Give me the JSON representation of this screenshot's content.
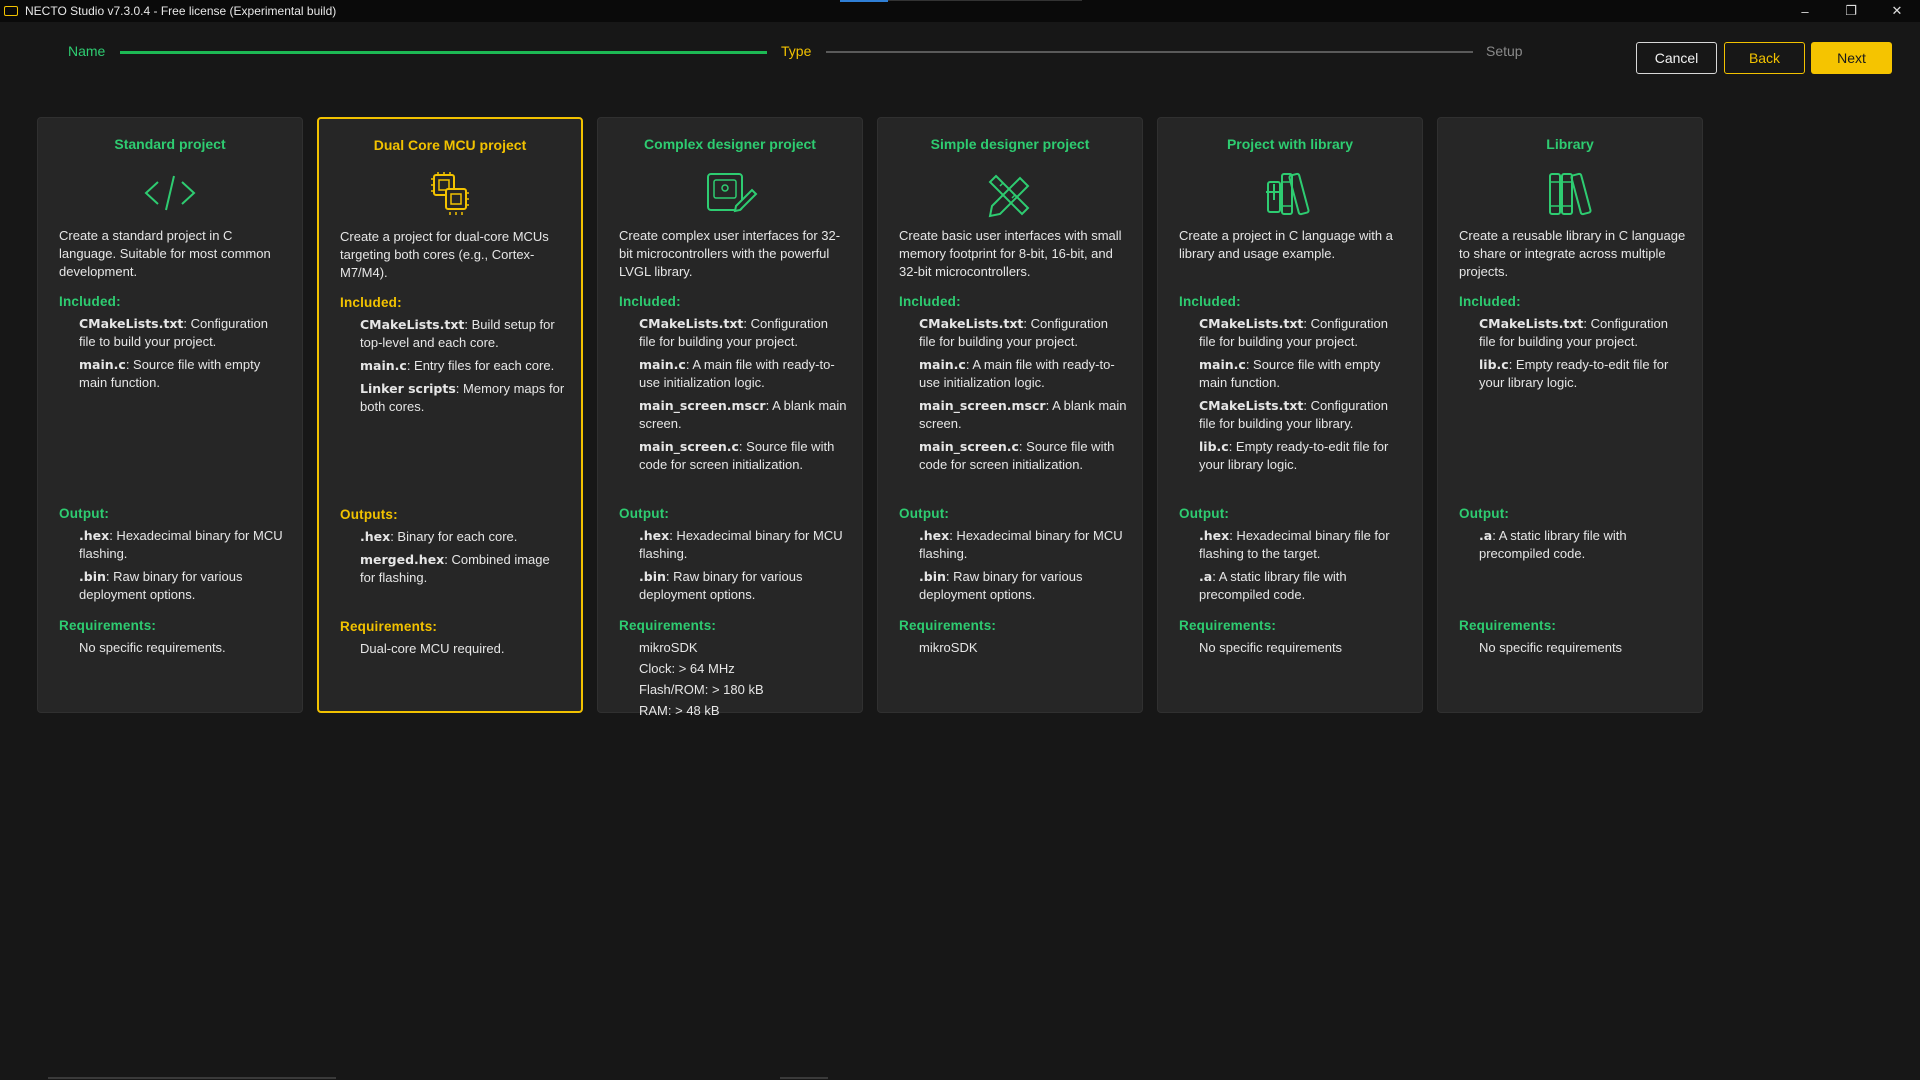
{
  "window": {
    "title": "NECTO Studio v7.3.0.4 - Free license (Experimental build)",
    "controls": {
      "minimize": "–",
      "restore": "❐",
      "close": "✕"
    }
  },
  "stepper": {
    "steps": [
      {
        "label": "Name",
        "state": "done"
      },
      {
        "label": "Type",
        "state": "current"
      },
      {
        "label": "Setup",
        "state": "pending"
      }
    ],
    "progress": 0.5
  },
  "buttons": {
    "cancel": "Cancel",
    "back": "Back",
    "next": "Next"
  },
  "colors": {
    "accent": "#f2c200",
    "green": "#2ecc71",
    "background": "#171717",
    "card": "#262626"
  },
  "cards": [
    {
      "title": "Standard project",
      "icon": "code-brackets-icon",
      "selected": false,
      "description": "Create a standard project in C language. Suitable for most common development.",
      "included_label": "Included:",
      "included": [
        {
          "name": "CMakeLists.txt",
          "text": ": Configuration file to build your project."
        },
        {
          "name": "main.c",
          "text": ": Source file with empty main function."
        }
      ],
      "output_label": "Output:",
      "output": [
        {
          "name": ".hex",
          "text": ": Hexadecimal binary for MCU flashing."
        },
        {
          "name": ".bin",
          "text": ": Raw binary for various deployment options."
        }
      ],
      "requirements_label": "Requirements:",
      "requirements": [
        "No specific requirements."
      ]
    },
    {
      "title": "Dual Core MCU project",
      "icon": "dual-chip-icon",
      "selected": true,
      "description": "Create a project for dual-core MCUs targeting both cores (e.g., Cortex-M7/M4).",
      "included_label": "Included:",
      "included": [
        {
          "name": "CMakeLists.txt",
          "text": ": Build setup for top-level and each core."
        },
        {
          "name": "main.c",
          "text": ": Entry files for each core."
        },
        {
          "name": "Linker scripts",
          "text": ": Memory maps for both cores."
        }
      ],
      "output_label": "Outputs:",
      "output": [
        {
          "name": ".hex",
          "text": ": Binary for each core."
        },
        {
          "name": "merged.hex",
          "text": ": Combined image for flashing."
        }
      ],
      "requirements_label": "Requirements:",
      "requirements": [
        "Dual-core MCU required."
      ]
    },
    {
      "title": "Complex designer project",
      "icon": "designer-screen-icon",
      "selected": false,
      "description": "Create complex user interfaces for 32-bit microcontrollers with the powerful LVGL library.",
      "included_label": "Included:",
      "included": [
        {
          "name": "CMakeLists.txt",
          "text": ": Configuration file for building your project."
        },
        {
          "name": "main.c",
          "text": ": A main file with ready-to-use initialization logic."
        },
        {
          "name": "main_screen.mscr",
          "text": ": A blank main screen."
        },
        {
          "name": "main_screen.c",
          "text": ": Source file with code for screen initialization."
        }
      ],
      "output_label": "Output:",
      "output": [
        {
          "name": ".hex",
          "text": ": Hexadecimal binary for MCU flashing."
        },
        {
          "name": ".bin",
          "text": ": Raw binary for various deployment options."
        }
      ],
      "requirements_label": "Requirements:",
      "requirements": [
        "mikroSDK",
        "Clock: > 64 MHz",
        "Flash/ROM: > 180 kB",
        "RAM: > 48 kB"
      ]
    },
    {
      "title": "Simple designer project",
      "icon": "pencil-ruler-icon",
      "selected": false,
      "description": "Create basic user interfaces with small memory footprint for 8-bit, 16-bit, and 32-bit microcontrollers.",
      "included_label": "Included:",
      "included": [
        {
          "name": "CMakeLists.txt",
          "text": ": Configuration file for building your project."
        },
        {
          "name": "main.c",
          "text": ": A main file with ready-to-use initialization logic."
        },
        {
          "name": "main_screen.mscr",
          "text": ": A blank main screen."
        },
        {
          "name": "main_screen.c",
          "text": ": Source file with code for screen initialization."
        }
      ],
      "output_label": "Output:",
      "output": [
        {
          "name": ".hex",
          "text": ": Hexadecimal binary for MCU flashing."
        },
        {
          "name": ".bin",
          "text": ": Raw binary for various deployment options."
        }
      ],
      "requirements_label": "Requirements:",
      "requirements": [
        "mikroSDK"
      ]
    },
    {
      "title": "Project with library",
      "icon": "books-plus-icon",
      "selected": false,
      "description": "Create a project in C language with a library and usage example.",
      "included_label": "Included:",
      "included": [
        {
          "name": "CMakeLists.txt",
          "text": ": Configuration file for building your project."
        },
        {
          "name": "main.c",
          "text": ": Source file with empty main function."
        },
        {
          "name": "CMakeLists.txt",
          "text": ": Configuration file for building your library."
        },
        {
          "name": "lib.c",
          "text": ": Empty ready-to-edit file for your library logic."
        }
      ],
      "output_label": "Output:",
      "output": [
        {
          "name": ".hex",
          "text": ": Hexadecimal binary file for flashing to the target."
        },
        {
          "name": ".a",
          "text": ": A static library file with precompiled code."
        }
      ],
      "requirements_label": "Requirements:",
      "requirements": [
        "No specific requirements"
      ]
    },
    {
      "title": "Library",
      "icon": "books-icon",
      "selected": false,
      "description": "Create a reusable library in C language to share or integrate across multiple projects.",
      "included_label": "Included:",
      "included": [
        {
          "name": "CMakeLists.txt",
          "text": ": Configuration file for building your project."
        },
        {
          "name": "lib.c",
          "text": ": Empty ready-to-edit file for your library logic."
        }
      ],
      "output_label": "Output:",
      "output": [
        {
          "name": ".a",
          "text": ": A static library file with precompiled code."
        }
      ],
      "requirements_label": "Requirements:",
      "requirements": [
        "No specific requirements"
      ]
    }
  ]
}
